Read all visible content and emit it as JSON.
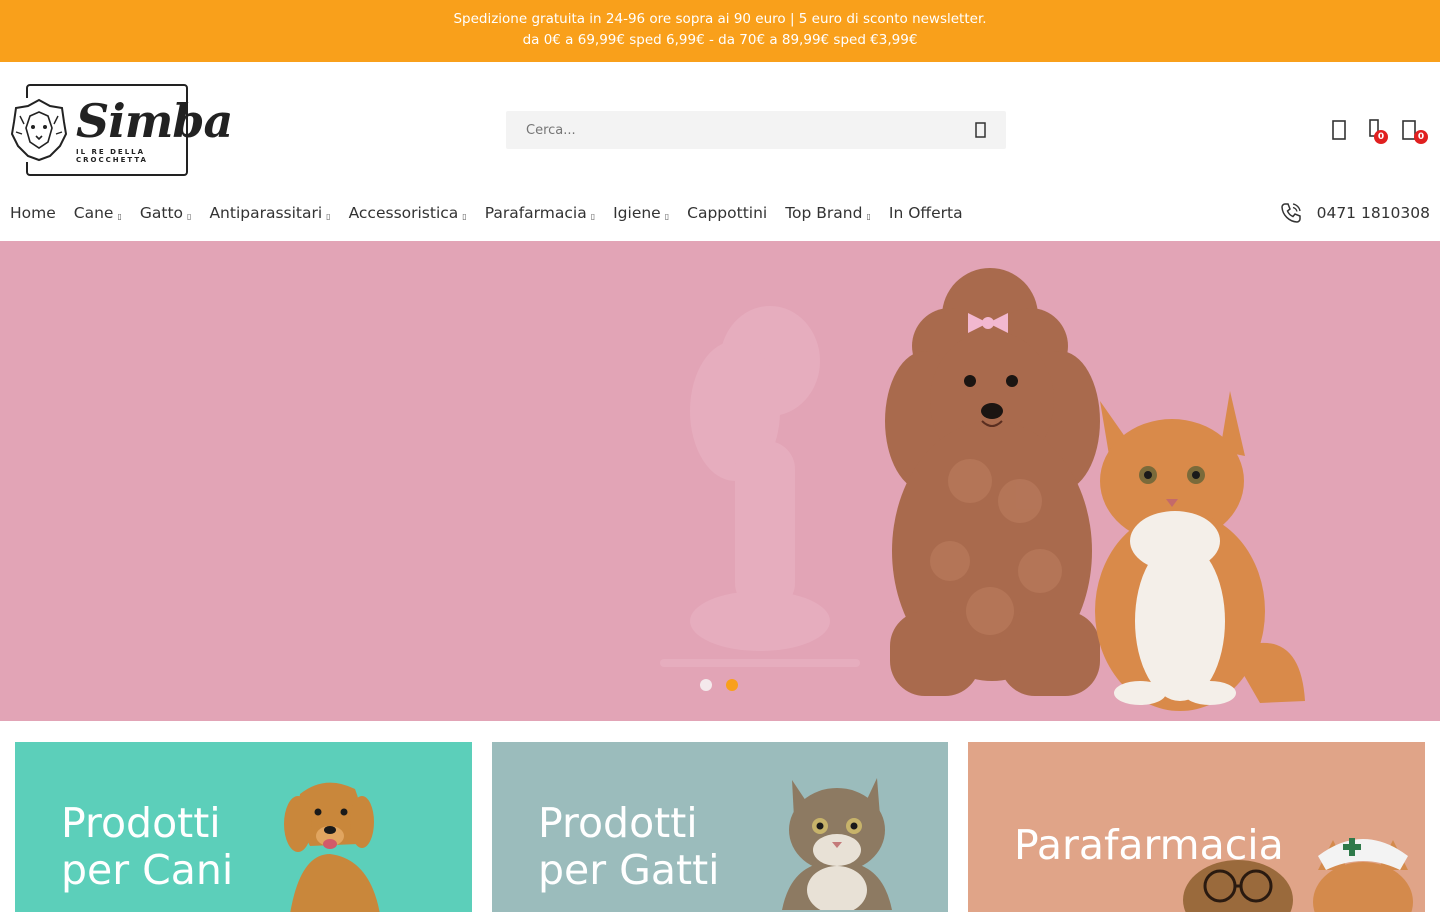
{
  "topbar": {
    "line1": "Spedizione gratuita in 24-96 ore sopra ai 90 euro | 5 euro di sconto newsletter.",
    "line2": "da 0€ a 69,99€ sped 6,99€ - da 70€ a 89,99€ sped €3,99€"
  },
  "logo": {
    "word": "Simba",
    "tagline": "IL RE DELLA CROCCHETTA"
  },
  "search": {
    "placeholder": "Cerca..."
  },
  "header_icons": {
    "compare_count": "0",
    "cart_count": "0"
  },
  "nav": {
    "items": [
      {
        "label": "Home",
        "dropdown": false
      },
      {
        "label": "Cane",
        "dropdown": true
      },
      {
        "label": "Gatto",
        "dropdown": true
      },
      {
        "label": "Antiparassitari",
        "dropdown": true
      },
      {
        "label": "Accessoristica",
        "dropdown": true
      },
      {
        "label": "Parafarmacia",
        "dropdown": true
      },
      {
        "label": "Igiene",
        "dropdown": true
      },
      {
        "label": "Cappottini",
        "dropdown": false
      },
      {
        "label": "Top Brand",
        "dropdown": true
      },
      {
        "label": "In Offerta",
        "dropdown": false
      }
    ],
    "phone": "0471 1810308"
  },
  "hero": {
    "slides_total": 2,
    "active_slide": 2,
    "background": "#e2a4b6"
  },
  "categories": [
    {
      "line1": "Prodotti",
      "line2": "per Cani",
      "color": "#5ccfba"
    },
    {
      "line1": "Prodotti",
      "line2": "per Gatti",
      "color": "#9bbcbc"
    },
    {
      "line1": "Parafarmacia",
      "line2": "",
      "color": "#e0a488"
    }
  ],
  "colors": {
    "accent": "#f9a01b",
    "badge": "#e02020"
  }
}
